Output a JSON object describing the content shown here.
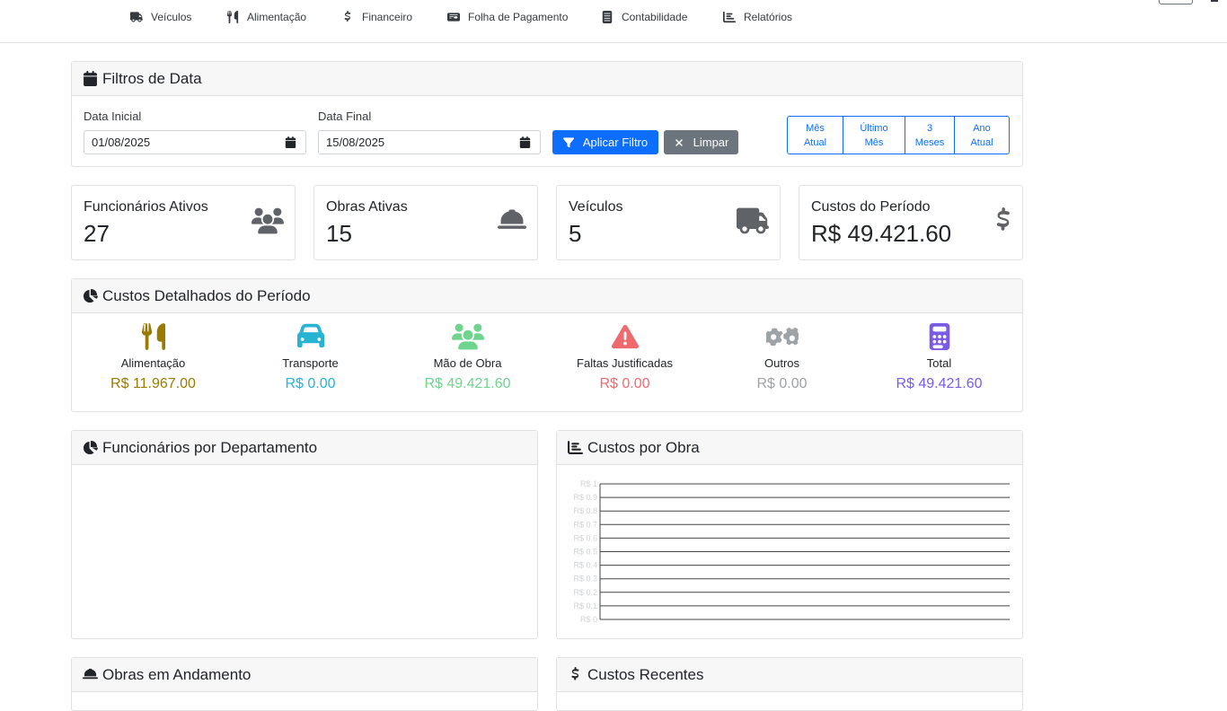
{
  "nav": {
    "items": [
      {
        "label": "Veículos",
        "icon": "truck-icon"
      },
      {
        "label": "Alimentação",
        "icon": "utensils-icon"
      },
      {
        "label": "Financeiro",
        "icon": "dollar-icon"
      },
      {
        "label": "Folha de Pagamento",
        "icon": "money-check-icon"
      },
      {
        "label": "Contabilidade",
        "icon": "file-invoice-icon"
      },
      {
        "label": "Relatórios",
        "icon": "chart-bar-icon"
      }
    ]
  },
  "filters": {
    "title": "Filtros de Data",
    "start_label": "Data Inicial",
    "start_value": "01/08/2025",
    "end_label": "Data Final",
    "end_value": "15/08/2025",
    "apply_label": "Aplicar Filtro",
    "clear_label": "Limpar",
    "quick": [
      {
        "line1": "Mês",
        "line2": "Atual"
      },
      {
        "line1": "Último",
        "line2": "Mês"
      },
      {
        "line1": "3",
        "line2": "Meses"
      },
      {
        "line1": "Ano",
        "line2": "Atual"
      }
    ]
  },
  "stats": [
    {
      "title": "Funcionários Ativos",
      "value": "27",
      "icon": "users-icon"
    },
    {
      "title": "Obras Ativas",
      "value": "15",
      "icon": "hard-hat-icon"
    },
    {
      "title": "Veículos",
      "value": "5",
      "icon": "truck-icon"
    },
    {
      "title": "Custos do Período",
      "value": "R$ 49.421.60",
      "icon": "dollar-icon"
    }
  ],
  "costs": {
    "title": "Custos Detalhados do Período",
    "items": [
      {
        "name": "Alimentação",
        "value": "R$ 11.967.00",
        "color": "#9a7a00",
        "icon": "utensils-icon"
      },
      {
        "name": "Transporte",
        "value": "R$ 0.00",
        "color": "#27b4d3",
        "icon": "car-icon"
      },
      {
        "name": "Mão de Obra",
        "value": "R$ 49.421.60",
        "color": "#6fd48e",
        "icon": "users-icon"
      },
      {
        "name": "Faltas Justificadas",
        "value": "R$ 0.00",
        "color": "#ef6a6f",
        "icon": "warning-icon"
      },
      {
        "name": "Outros",
        "value": "R$ 0.00",
        "color": "#9ea3a8",
        "icon": "cogs-icon"
      },
      {
        "name": "Total",
        "value": "R$ 49.421.60",
        "color": "#7a5be6",
        "icon": "calculator-icon"
      }
    ]
  },
  "dept_panel": {
    "title": "Funcionários por Departamento"
  },
  "obra_chart_panel": {
    "title": "Custos por Obra"
  },
  "chart_data": {
    "type": "bar",
    "title": "",
    "categories": [],
    "values": [],
    "ylim": [
      0,
      1
    ],
    "yticks": [
      "R$ 0",
      "R$ 0.1",
      "R$ 0.2",
      "R$ 0.3",
      "R$ 0.4",
      "R$ 0.5",
      "R$ 0.6",
      "R$ 0.7",
      "R$ 0.8",
      "R$ 0.9",
      "R$ 1"
    ],
    "grid": true
  },
  "obras_panel": {
    "title": "Obras em Andamento"
  },
  "recent_panel": {
    "title": "Custos Recentes"
  }
}
